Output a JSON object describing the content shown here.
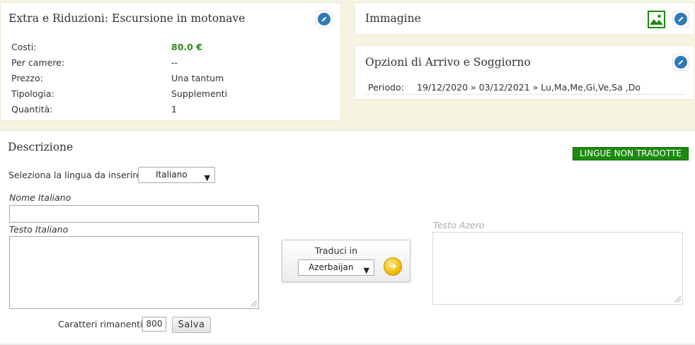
{
  "extras_panel": {
    "title": "Extra e Riduzioni: Escursione in motonave",
    "rows": [
      {
        "label": "Costi:",
        "value": "80.0 €"
      },
      {
        "label": "Per camere:",
        "value": "--"
      },
      {
        "label": "Prezzo:",
        "value": "Una tantum"
      },
      {
        "label": "Tipologia:",
        "value": "Supplementi"
      },
      {
        "label": "Quantità:",
        "value": "1"
      }
    ]
  },
  "image_panel": {
    "title": "Immagine"
  },
  "options_panel": {
    "title": "Opzioni di Arrivo e Soggiorno",
    "period_label": "Periodo:",
    "period_value": "19/12/2020 » 03/12/2021 » Lu,Ma,Me,Gi,Ve,Sa ,Do"
  },
  "description": {
    "title": "Descrizione",
    "badge": "LINGUE NON TRADOTTE",
    "lang_label": "Seleziona la lingua da inserire",
    "lang_selected": "Italiano",
    "name_label": "Nome Italiano",
    "name_value": "",
    "text_label": "Testo Italiano",
    "text_value": "",
    "translate_label": "Traduci in",
    "translate_selected": "Azerbaijan",
    "target_label": "Testo Azero",
    "chars_label": "Caratteri rimanenti",
    "chars_value": "800",
    "save_label": "Salva"
  },
  "colors": {
    "accent_blue": "#2f7ab9",
    "green": "#1c8a0f",
    "band": "#f6f3e1"
  }
}
